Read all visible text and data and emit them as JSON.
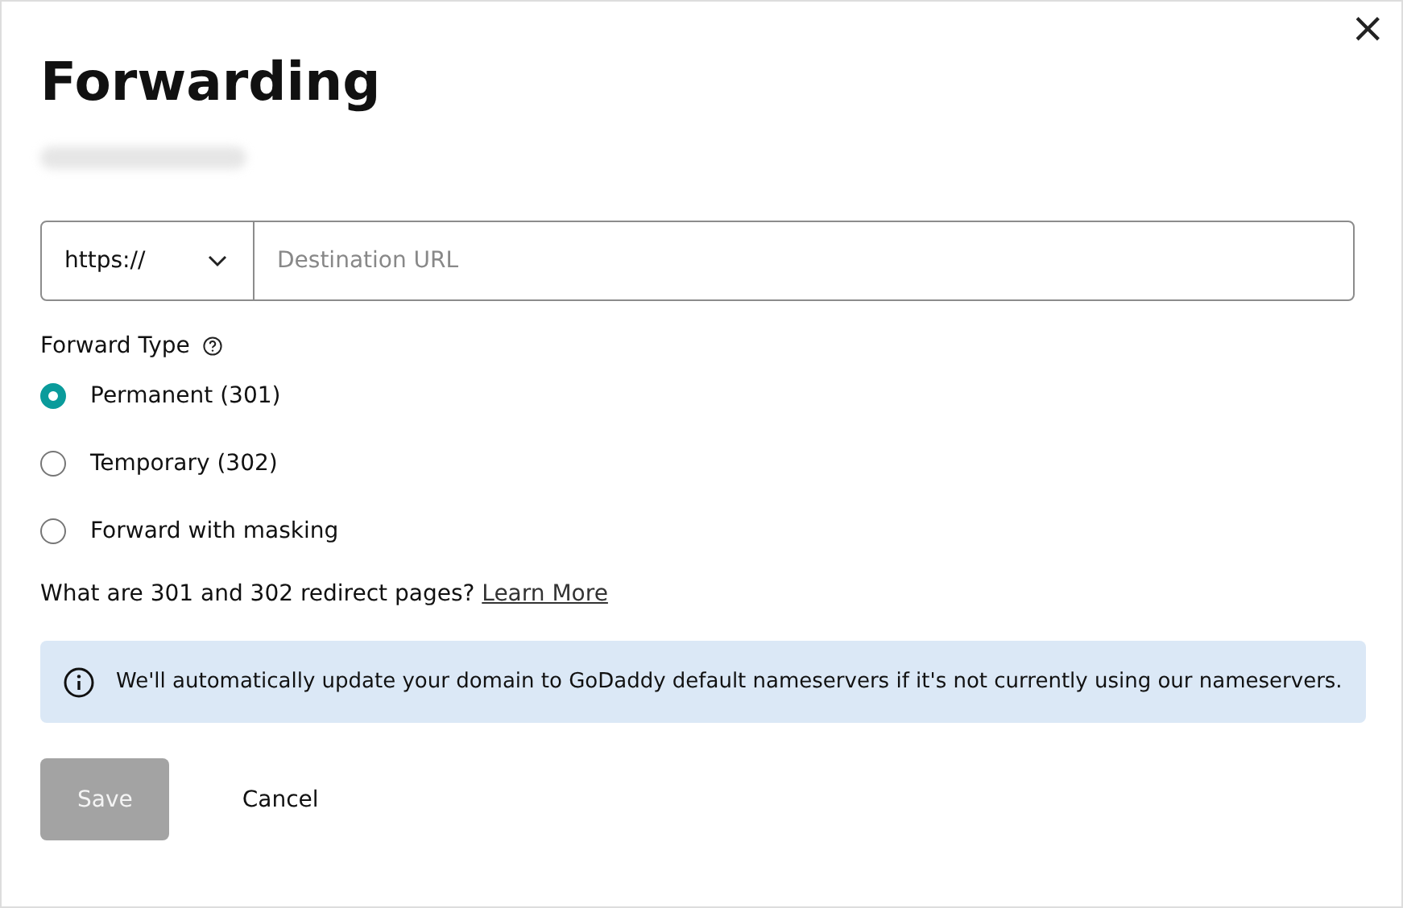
{
  "dialog": {
    "title": "Forwarding",
    "close": "×"
  },
  "url_field": {
    "protocol": "https://",
    "placeholder": "Destination URL"
  },
  "forward_type": {
    "label": "Forward Type",
    "options": [
      {
        "label": "Permanent (301)",
        "selected": true
      },
      {
        "label": "Temporary (302)",
        "selected": false
      },
      {
        "label": "Forward with masking",
        "selected": false
      }
    ]
  },
  "help": {
    "text": "What are 301 and 302 redirect pages?",
    "link": "Learn More"
  },
  "notice": {
    "text": "We'll automatically update your domain to GoDaddy default nameservers if it's not currently using our nameservers."
  },
  "buttons": [
    {
      "label": "Save",
      "kind": "primary",
      "disabled": true
    },
    {
      "label": "Cancel",
      "kind": "text",
      "disabled": false
    }
  ]
}
